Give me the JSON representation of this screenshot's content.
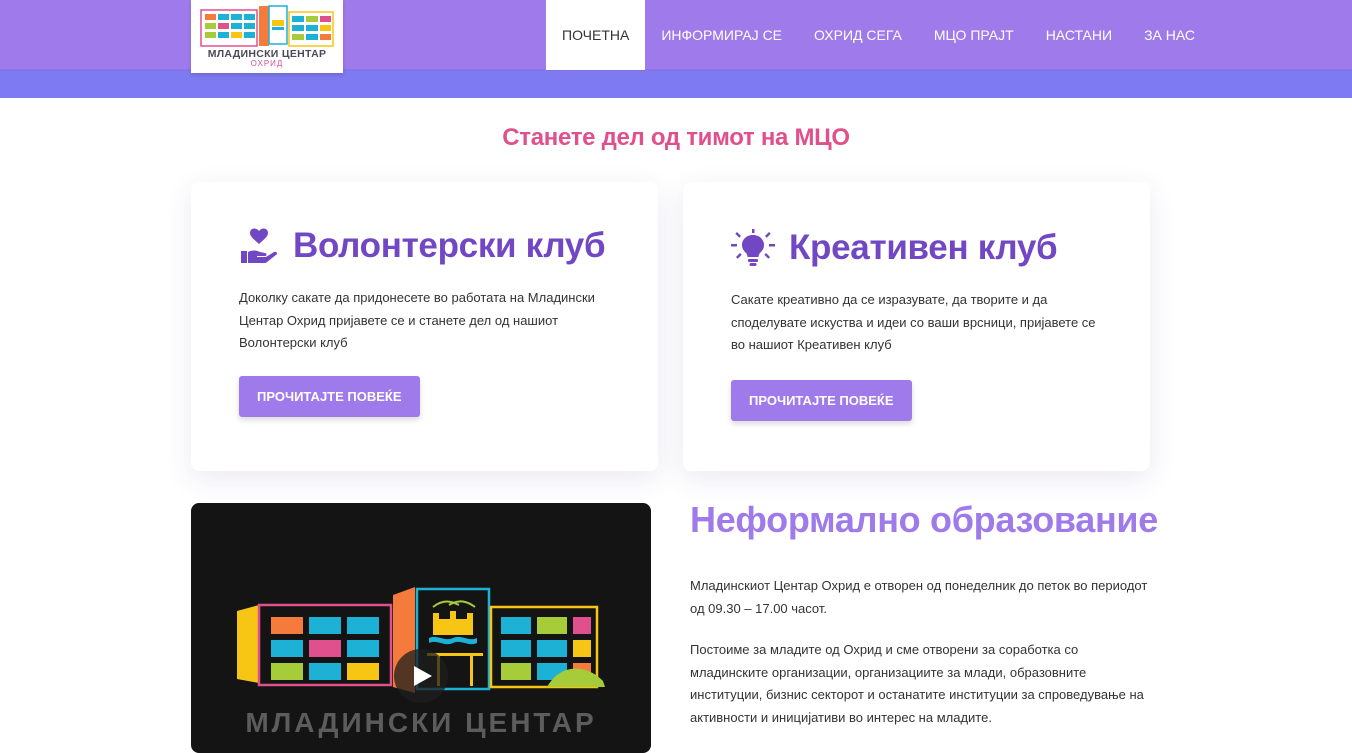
{
  "header": {
    "logo": {
      "title": "МЛАДИНСКИ ЦЕНТАР",
      "subtitle": "ОХРИД"
    },
    "nav": [
      {
        "label": "ПОЧЕТНА",
        "active": true
      },
      {
        "label": "ИНФОРМИРАЈ СЕ",
        "active": false
      },
      {
        "label": "ОХРИД СЕГА",
        "active": false
      },
      {
        "label": "МЦО ПРАЈТ",
        "active": false
      },
      {
        "label": "НАСТАНИ",
        "active": false
      },
      {
        "label": "ЗА НАС",
        "active": false
      }
    ]
  },
  "team_section": {
    "title": "Станете дел од тимот на МЦО",
    "cards": [
      {
        "icon": "hand-heart-icon",
        "title": "Волонтерски клуб",
        "text": "Доколку сакате да придонесете во работата на Младински Центар Охрид пријавете се и станете дел од нашиот Волонтерски клуб",
        "button": "ПРОЧИТАЈТЕ ПОВЕЌЕ"
      },
      {
        "icon": "lightbulb-icon",
        "title": "Креативен клуб",
        "text": "Сакате креативно да се изразувате, да творите и да споделувате искуства и идеи со ваши врсници, пријавете се во нашиот Креативен клуб",
        "button": "ПРОЧИТАЈТЕ ПОВЕЌЕ"
      }
    ]
  },
  "video": {
    "title": "МЛАДИНСКИ ЦЕНТАР",
    "play_icon": "play-icon"
  },
  "education": {
    "title": "Неформално образование",
    "paragraphs": [
      "Младинскиот Центар Охрид е отворен од понеделник до петок во периодот од 09.30 – 17.00 часот.",
      "Постоиме за младите од Охрид и сме отворени за соработка со младинските организации, организациите за млади, образовните институции, бизнис секторот и останатите институции за спроведување на активности и иницијативи во интерес на младите."
    ]
  },
  "colors": {
    "accent": "#9f7aea",
    "title_pink": "#e0508d",
    "card_title": "#7147c4"
  }
}
